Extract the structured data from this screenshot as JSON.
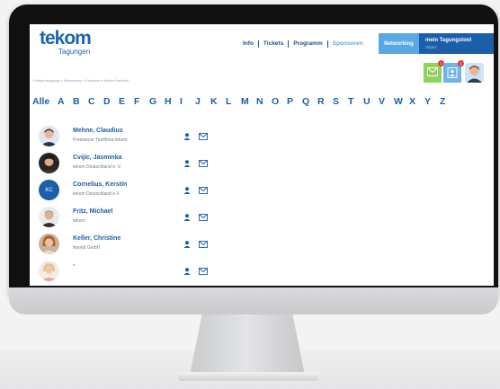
{
  "header": {
    "logo_text": "tekom",
    "logo_sub": "Tagungen",
    "nav": [
      "Info",
      "Tickets",
      "Programm",
      "Sponsoren"
    ],
    "tab_networking": "Networking",
    "tab_tool_title": "mein Tagungstool",
    "tab_tool_sub": "Status"
  },
  "actions": {
    "mail_badge": "1",
    "contacts_badge": "2"
  },
  "breadcrumb": "Frühjahrstagung » Networking » Kontakte » Meine Kontakte",
  "alphabet": [
    "Alle",
    "A",
    "B",
    "C",
    "D",
    "E",
    "F",
    "G",
    "H",
    "I",
    "J",
    "K",
    "L",
    "M",
    "N",
    "O",
    "P",
    "Q",
    "R",
    "S",
    "T",
    "U",
    "V",
    "W",
    "X",
    "Y",
    "Z"
  ],
  "contacts": [
    {
      "name": "Mehne, Claudius",
      "org": "Freelancer Testfirma tekom",
      "initials": ""
    },
    {
      "name": "Cvijic, Jasminka",
      "org": "tekom Deutschland e. V.",
      "initials": ""
    },
    {
      "name": "Cornelius, Kerstin",
      "org": "tekom Deutschland e.V.",
      "initials": "KC"
    },
    {
      "name": "Fritz, Michael",
      "org": "tekom",
      "initials": ""
    },
    {
      "name": "Keller, Christine",
      "org": "itworld GmbH",
      "initials": ""
    },
    {
      "name": "-",
      "org": "",
      "initials": ""
    }
  ],
  "colors": {
    "brand_dark": "#1a5fa8",
    "brand_light": "#5aa8e3",
    "mail_button": "#8fd35a",
    "contacts_button": "#6fb4e8",
    "badge": "#e53b2e"
  },
  "icons": [
    "person-icon",
    "mail-icon",
    "envelope-icon",
    "address-book-icon"
  ]
}
